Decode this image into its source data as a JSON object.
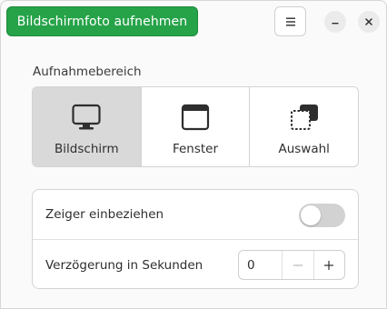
{
  "headerbar": {
    "capture_label": "Bildschirmfoto aufnehmen",
    "menu_icon": "hamburger-menu-icon",
    "minimize_icon": "minimize-icon",
    "close_icon": "close-icon",
    "accent_color": "#26a349"
  },
  "area": {
    "section_label": "Aufnahmebereich",
    "options": [
      {
        "label": "Bildschirm",
        "icon": "monitor-icon",
        "selected": true
      },
      {
        "label": "Fenster",
        "icon": "window-icon",
        "selected": false
      },
      {
        "label": "Auswahl",
        "icon": "selection-icon",
        "selected": false
      }
    ]
  },
  "options": {
    "pointer": {
      "label": "Zeiger einbeziehen",
      "enabled": false
    },
    "delay": {
      "label": "Verzögerung in Sekunden",
      "value": "0",
      "decrement_icon": "minus-icon",
      "increment_icon": "plus-icon"
    }
  }
}
